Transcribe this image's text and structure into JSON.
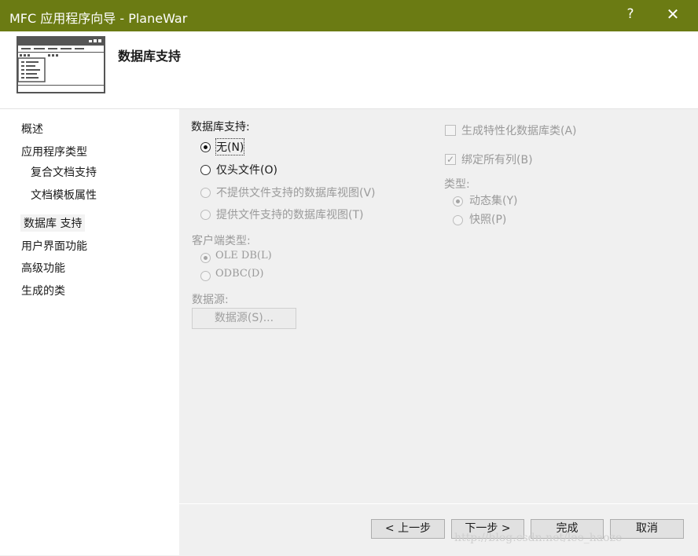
{
  "window": {
    "title": "MFC 应用程序向导 - PlaneWar",
    "help_glyph": "?",
    "close_glyph": "✕"
  },
  "header": {
    "title": "数据库支持"
  },
  "nav": {
    "items": [
      {
        "label": "概述"
      },
      {
        "label": "应用程序类型"
      },
      {
        "label": "复合文档支持"
      },
      {
        "label": "文档模板属性"
      },
      {
        "label": "数据库 支持"
      },
      {
        "label": "用户界面功能"
      },
      {
        "label": "高级功能"
      },
      {
        "label": "生成的类"
      }
    ],
    "selected_index": 4
  },
  "db_support": {
    "label": "数据库支持:",
    "options": [
      {
        "label": "无(N)",
        "checked": true,
        "enabled": true
      },
      {
        "label": "仅头文件(O)",
        "checked": false,
        "enabled": true
      },
      {
        "label": "不提供文件支持的数据库视图(V)",
        "checked": false,
        "enabled": false
      },
      {
        "label": "提供文件支持的数据库视图(T)",
        "checked": false,
        "enabled": false
      }
    ]
  },
  "client_type": {
    "label": "客户端类型:",
    "options": [
      {
        "label": "OLE DB(L)",
        "checked": true,
        "enabled": false
      },
      {
        "label": "ODBC(D)",
        "checked": false,
        "enabled": false
      }
    ]
  },
  "data_source": {
    "label": "数据源:",
    "button_label": "数据源(S)..."
  },
  "right_panel": {
    "gen_classes_label": "生成特性化数据库类(A)",
    "gen_classes_checked": false,
    "bind_columns_label": "绑定所有列(B)",
    "bind_columns_checked": true,
    "type_label": "类型:",
    "type_options": [
      {
        "label": "动态集(Y)",
        "checked": true
      },
      {
        "label": "快照(P)",
        "checked": false
      }
    ]
  },
  "footer": {
    "prev_label": "< 上一步",
    "next_label": "下一步 >",
    "finish_label": "完成",
    "cancel_label": "取消"
  },
  "watermark": "http://blog.csdn.net/lee_haoze"
}
